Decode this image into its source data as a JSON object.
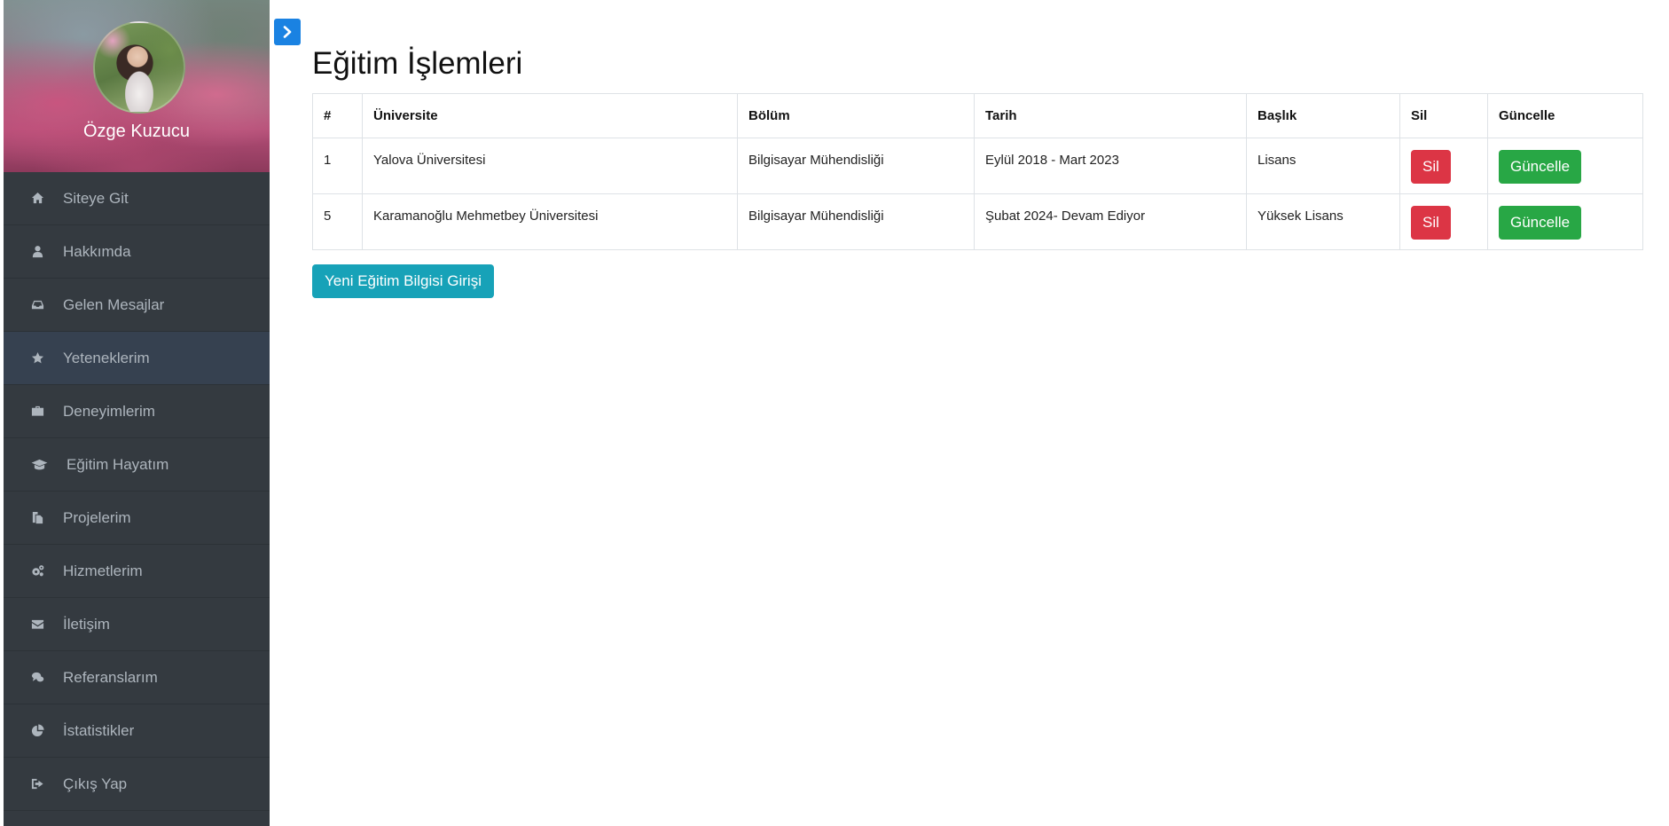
{
  "sidebar": {
    "profile_name": "Özge Kuzucu",
    "items": [
      {
        "label": "Siteye Git",
        "icon": "home-icon"
      },
      {
        "label": "Hakkımda",
        "icon": "user-icon"
      },
      {
        "label": "Gelen Mesajlar",
        "icon": "inbox-icon"
      },
      {
        "label": "Yeteneklerim",
        "icon": "star-icon",
        "active": true
      },
      {
        "label": "Deneyimlerim",
        "icon": "briefcase-icon"
      },
      {
        "label": "Eğitim Hayatım",
        "icon": "graduation-cap-icon"
      },
      {
        "label": "Projelerim",
        "icon": "files-icon"
      },
      {
        "label": "Hizmetlerim",
        "icon": "gears-icon"
      },
      {
        "label": "İletişim",
        "icon": "envelope-icon"
      },
      {
        "label": "Referanslarım",
        "icon": "comments-icon"
      },
      {
        "label": "İstatistikler",
        "icon": "pie-chart-icon"
      },
      {
        "label": "Çıkış Yap",
        "icon": "sign-out-icon"
      }
    ]
  },
  "toggle": {
    "icon": "chevron-right-icon",
    "color": "#1a82e2"
  },
  "page": {
    "title": "Eğitim İşlemleri"
  },
  "table": {
    "headers": [
      "#",
      "Üniversite",
      "Bölüm",
      "Tarih",
      "Başlık",
      "Sil",
      "Güncelle"
    ],
    "rows": [
      {
        "id": "1",
        "universite": "Yalova Üniversitesi",
        "bolum": "Bilgisayar Mühendisliği",
        "tarih": "Eylül 2018 - Mart 2023",
        "baslik": "Lisans",
        "sil": "Sil",
        "guncelle": "Güncelle"
      },
      {
        "id": "5",
        "universite": "Karamanoğlu Mehmetbey Üniversitesi",
        "bolum": "Bilgisayar Mühendisliği",
        "tarih": "Şubat 2024- Devam Ediyor",
        "baslik": "Yüksek Lisans",
        "sil": "Sil",
        "guncelle": "Güncelle"
      }
    ]
  },
  "new_button": {
    "label": "Yeni Eğitim Bilgisi Girişi"
  },
  "colors": {
    "danger": "#dc3545",
    "success": "#28a745",
    "info": "#17a2b8",
    "sidebar_bg": "#343a40",
    "sidebar_active": "#364150"
  }
}
